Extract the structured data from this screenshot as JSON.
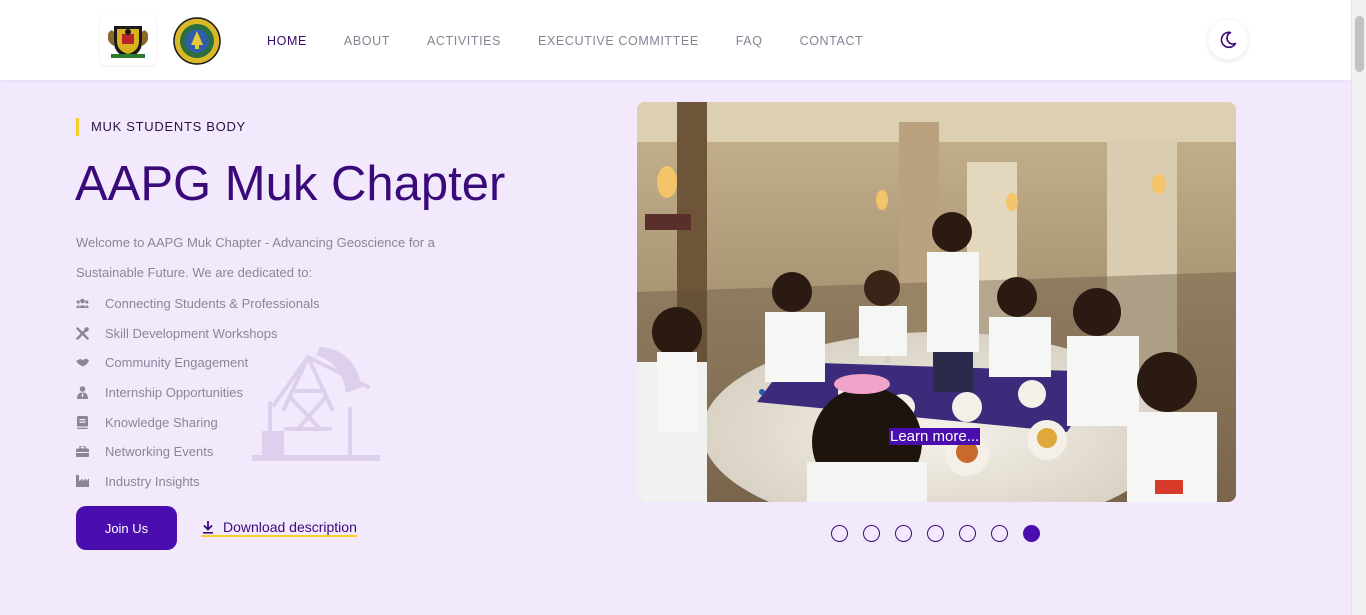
{
  "nav": {
    "items": [
      {
        "label": "HOME",
        "active": true
      },
      {
        "label": "ABOUT",
        "active": false
      },
      {
        "label": "ACTIVITIES",
        "active": false
      },
      {
        "label": "EXECUTIVE COMMITTEE",
        "active": false
      },
      {
        "label": "FAQ",
        "active": false
      },
      {
        "label": "CONTACT",
        "active": false
      }
    ],
    "theme_toggle_icon": "moon-icon"
  },
  "hero": {
    "eyebrow": "MUK STUDENTS BODY",
    "title": "AAPG Muk Chapter",
    "intro": "Welcome to AAPG Muk Chapter - Advancing Geoscience for a Sustainable Future. We are dedicated to:",
    "features": [
      {
        "label": "Connecting Students & Professionals",
        "icon": "users-icon"
      },
      {
        "label": "Skill Development Workshops",
        "icon": "tools-icon"
      },
      {
        "label": "Community Engagement",
        "icon": "handshake-icon"
      },
      {
        "label": "Internship Opportunities",
        "icon": "user-tie-icon"
      },
      {
        "label": "Knowledge Sharing",
        "icon": "book-icon"
      },
      {
        "label": "Networking Events",
        "icon": "briefcase-icon"
      },
      {
        "label": "Industry Insights",
        "icon": "industry-icon"
      }
    ],
    "join_label": "Join Us",
    "download_label": "Download description"
  },
  "carousel": {
    "learn_more": "Learn more...",
    "slide_count": 7,
    "active_index": 6
  },
  "colors": {
    "background": "#f3e9fd",
    "primary": "#4a0eae",
    "title": "#3a0a7a",
    "accent": "#f2cf2a",
    "muted_text": "#8b8598"
  }
}
